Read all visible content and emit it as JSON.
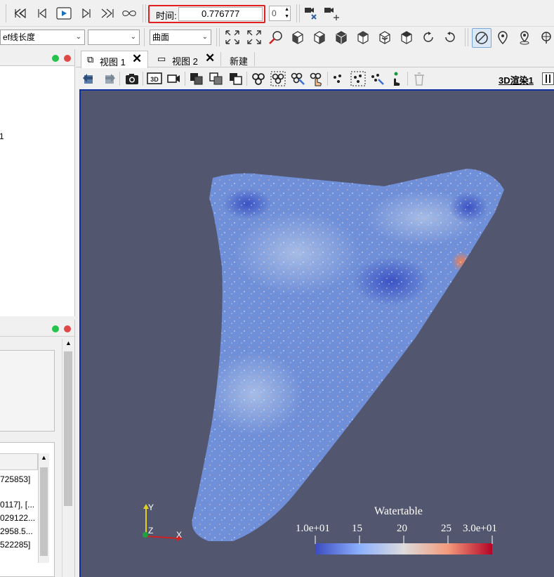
{
  "toolbar": {
    "time_label": "时间:",
    "time_value": "0.776777",
    "timestep_value": "0"
  },
  "row2": {
    "color_by_value": "ef线长度",
    "component_value": "",
    "representation_value": "曲面"
  },
  "tabs": [
    {
      "label": "视图 1"
    },
    {
      "label": "视图 2"
    },
    {
      "label": "新建"
    }
  ],
  "view": {
    "render_label": "3D渲染1",
    "axes": {
      "y": "Y",
      "z": "Z",
      "x": "X"
    }
  },
  "left_panel": {
    "pipeline_fragment": "1",
    "rows": [
      "725853]",
      "",
      "0117], [...",
      "029122...",
      "2958.5...",
      "522285]"
    ]
  },
  "colorbar": {
    "title": "Watertable",
    "ticks": [
      "1.0e+01",
      "15",
      "20",
      "25",
      "3.0e+01"
    ],
    "range": [
      10,
      30
    ],
    "tick_values": [
      10,
      15,
      20,
      25,
      30
    ],
    "colors": [
      "#3b4cc0",
      "#8db0fe",
      "#dddcdc",
      "#f49a7b",
      "#b40426"
    ]
  },
  "colors": {
    "background": "#52566f",
    "selection_frame": "#e02020",
    "view_border": "#1030a0"
  }
}
